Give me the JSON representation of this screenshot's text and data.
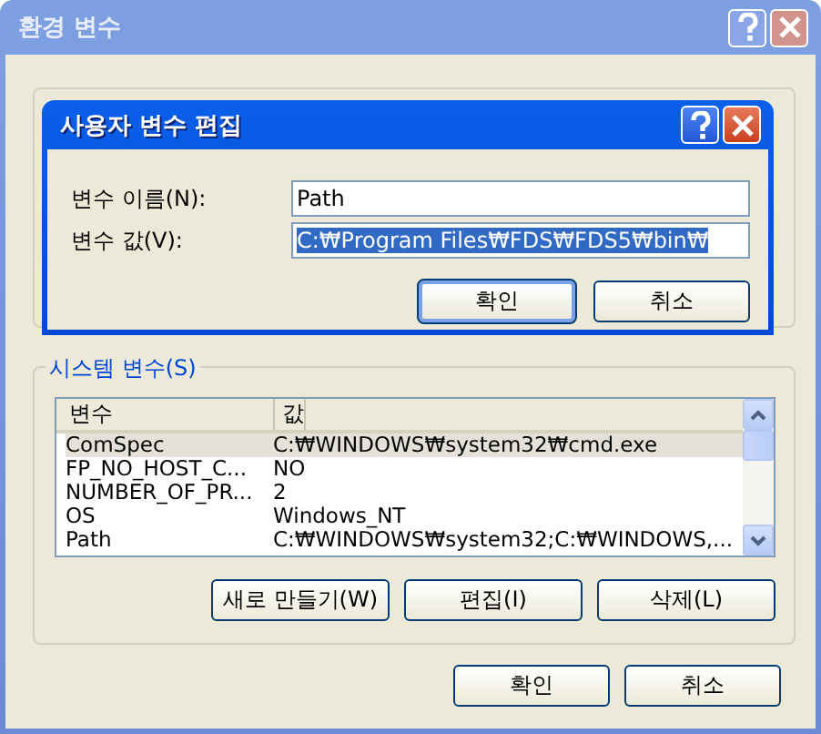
{
  "window": {
    "title": "환경 변수"
  },
  "system_variables": {
    "legend": "시스템 변수(S)",
    "columns": [
      "변수",
      "값"
    ],
    "rows": [
      {
        "name": "ComSpec",
        "value": "C:₩WINDOWS₩system32₩cmd.exe",
        "selected": true
      },
      {
        "name": "FP_NO_HOST_C...",
        "value": "NO",
        "selected": false
      },
      {
        "name": "NUMBER_OF_PR...",
        "value": "2",
        "selected": false
      },
      {
        "name": "OS",
        "value": "Windows_NT",
        "selected": false
      },
      {
        "name": "Path",
        "value": "C:₩WINDOWS₩system32;C:₩WINDOWS,...",
        "selected": false
      }
    ],
    "buttons": [
      "새로 만들기(W)",
      "편집(I)",
      "삭제(L)"
    ]
  },
  "buttons": [
    "확인",
    "취소"
  ],
  "dialog": {
    "title": "사용자 변수 편집",
    "fields": [
      {
        "label": "변수 이름(N):",
        "value": "Path",
        "text_selected": false
      },
      {
        "label": "변수 값(V):",
        "value": "C:₩Program Files₩FDS₩FDS5₩bin₩",
        "text_selected": true
      }
    ],
    "buttons": [
      {
        "label": "확인",
        "default": true
      },
      {
        "label": "취소",
        "default": false
      }
    ]
  }
}
